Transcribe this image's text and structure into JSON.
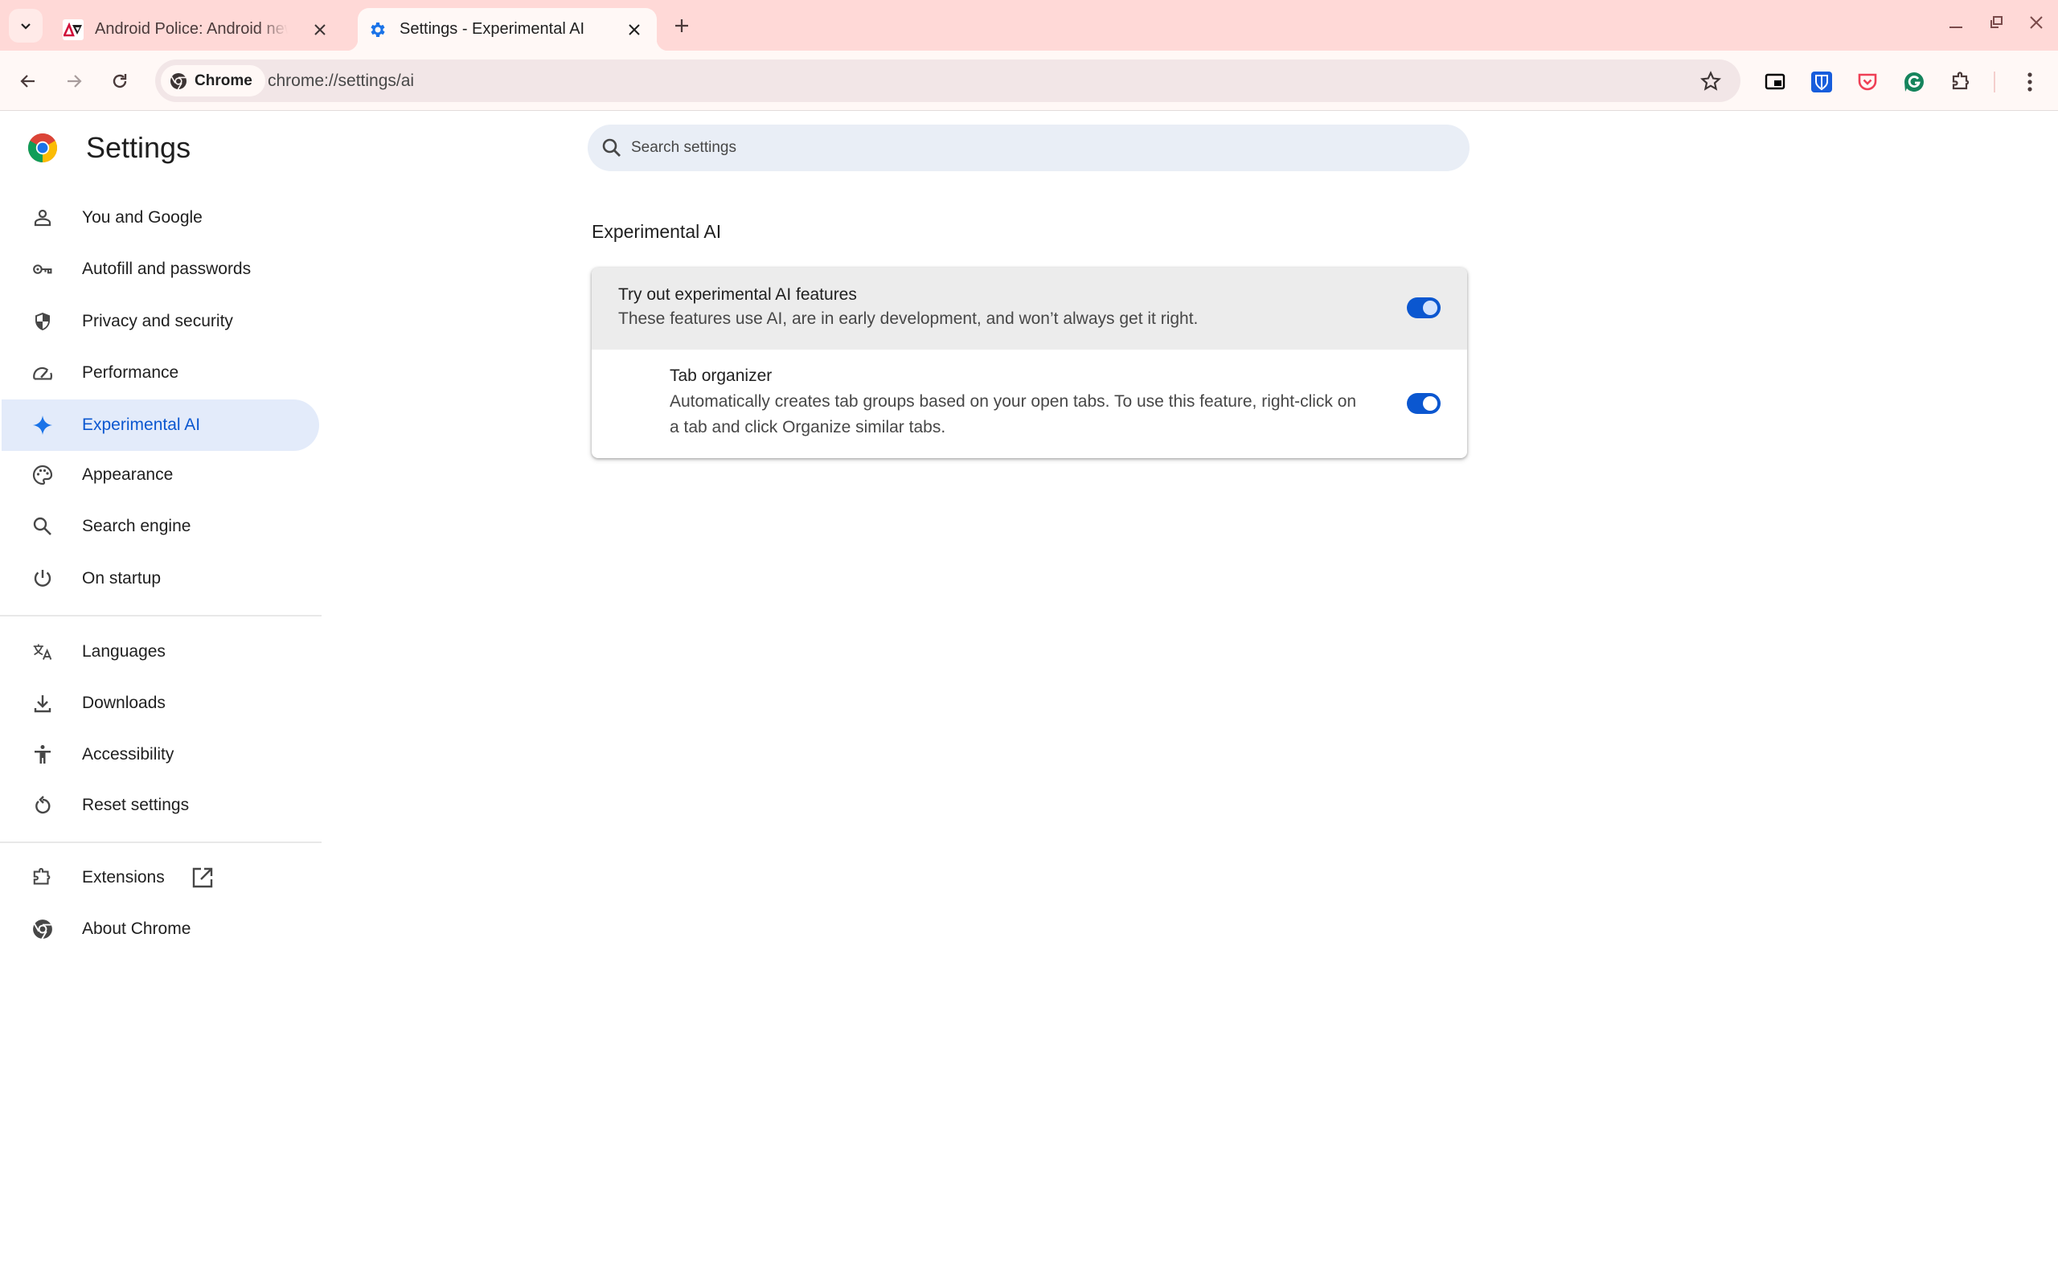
{
  "browser": {
    "tabs": [
      {
        "title": "Android Police: Android news, reviews, apps, games, phones, tablets",
        "favicon": "android-police-favicon",
        "active": false
      },
      {
        "title": "Settings - Experimental AI",
        "favicon": "gear-icon",
        "active": true
      }
    ],
    "omnibox": {
      "chip_label": "Chrome",
      "url": "chrome://settings/ai"
    },
    "extensions": [
      "picture-in-picture",
      "bitwarden",
      "pocket",
      "grammarly",
      "extensions-puzzle"
    ],
    "colors": {
      "tabstrip": "#ffd9d7",
      "toolbar": "#fff8f6",
      "accent": "#0b57d0"
    }
  },
  "sidebar": {
    "title": "Settings",
    "groups": [
      [
        {
          "label": "You and Google",
          "icon": "person-icon"
        },
        {
          "label": "Autofill and passwords",
          "icon": "key-icon"
        },
        {
          "label": "Privacy and security",
          "icon": "shield-icon"
        },
        {
          "label": "Performance",
          "icon": "speedometer-icon"
        },
        {
          "label": "Experimental AI",
          "icon": "sparkle-icon",
          "selected": true
        },
        {
          "label": "Appearance",
          "icon": "palette-icon"
        },
        {
          "label": "Search engine",
          "icon": "search-icon"
        },
        {
          "label": "On startup",
          "icon": "power-icon"
        }
      ],
      [
        {
          "label": "Languages",
          "icon": "translate-icon"
        },
        {
          "label": "Downloads",
          "icon": "download-icon"
        },
        {
          "label": "Accessibility",
          "icon": "accessibility-icon"
        },
        {
          "label": "Reset settings",
          "icon": "reset-icon"
        }
      ],
      [
        {
          "label": "Extensions",
          "icon": "puzzle-icon",
          "external": true
        },
        {
          "label": "About Chrome",
          "icon": "chrome-icon"
        }
      ]
    ]
  },
  "main": {
    "search_placeholder": "Search settings",
    "section_title": "Experimental AI",
    "settings": [
      {
        "title": "Try out experimental AI features",
        "description": "These features use AI, are in early development, and won’t always get it right.",
        "enabled": true
      },
      {
        "title": "Tab organizer",
        "description": "Automatically creates tab groups based on your open tabs. To use this feature, right-click on a tab and click Organize similar tabs.",
        "enabled": true
      }
    ]
  }
}
